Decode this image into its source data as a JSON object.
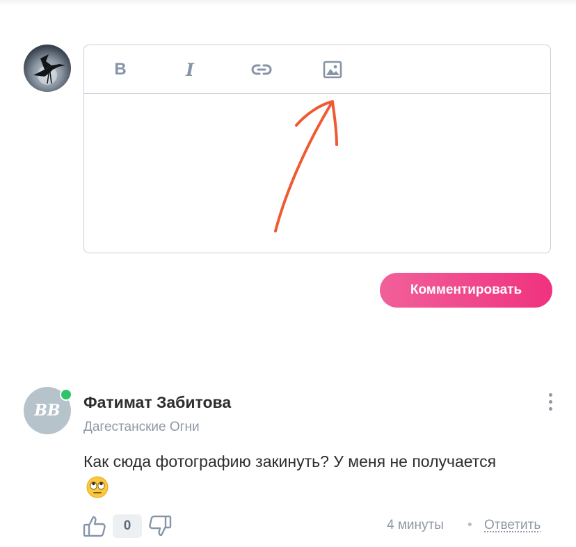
{
  "editor": {
    "toolbar": {
      "bold_label": "B",
      "italic_label": "I",
      "link_icon": "link-icon",
      "image_icon": "image-icon"
    },
    "content": ""
  },
  "annotation": {
    "arrow_color": "#ef5a33"
  },
  "submit_label": "Комментировать",
  "comment": {
    "author": "Фатимат Забитова",
    "source": "Дагестанские Огни",
    "avatar_initials": "BB",
    "online": true,
    "text": "Как сюда фотографию закинуть? У меня не получается",
    "emoji": "face-with-rolling-eyes",
    "likes": "0",
    "time": "4 минуты",
    "separator": "•",
    "reply_label": "Ответить"
  },
  "colors": {
    "accent_pink": "#f0327f",
    "online_green": "#2fc36a",
    "muted_text": "#8e97a3",
    "toolbar_icon": "#8794a8"
  }
}
